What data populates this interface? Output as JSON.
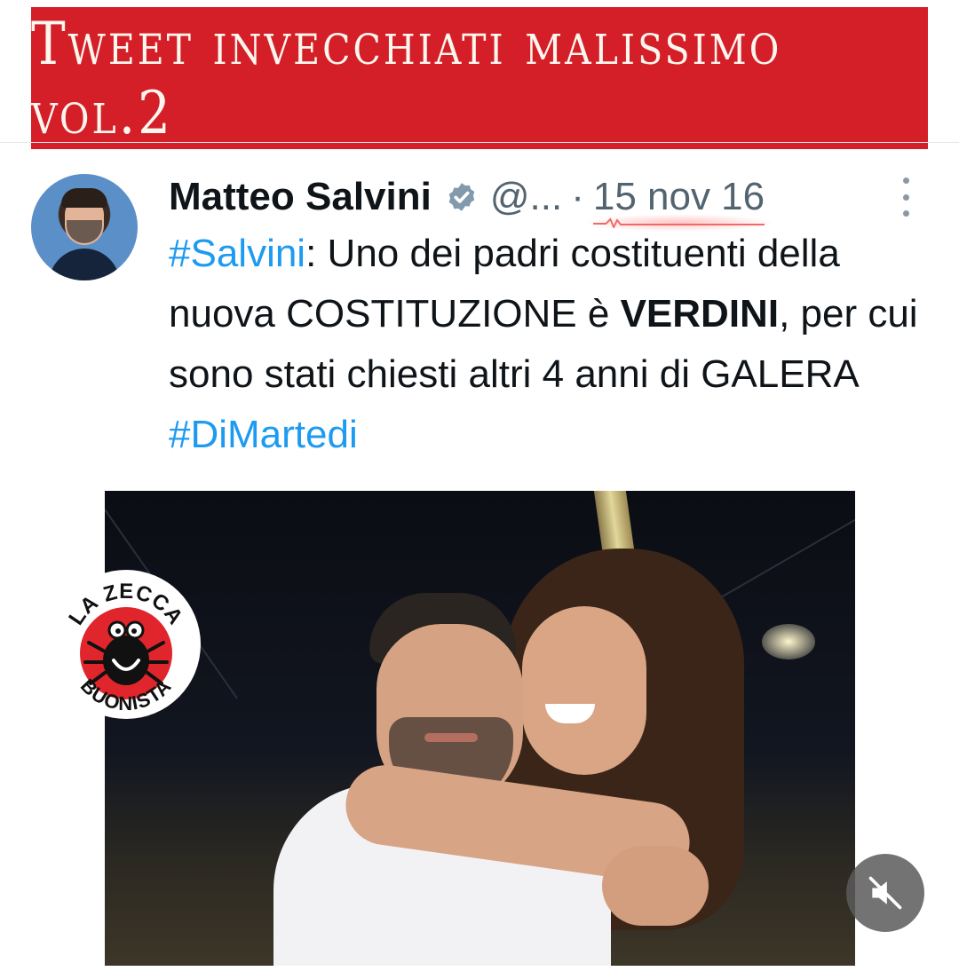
{
  "banner": {
    "title": "Tweet invecchiati malissimo vol.2"
  },
  "tweet": {
    "author_name": "Matteo Salvini",
    "handle": "@...",
    "separator": "·",
    "date": "15 nov 16",
    "text": {
      "hashtag_1": "#Salvini",
      "part_1": ": Uno dei padri costituenti della nuova COSTITUZIONE è ",
      "bold": "VERDINI",
      "part_2": ", per cui sono stati chiesti altri 4 anni di GALERA ",
      "hashtag_2": "#DiMartedi"
    }
  },
  "logo": {
    "top_text": "LA ZECCA",
    "bottom_text": "BUONISTA"
  },
  "colors": {
    "banner": "#d41f28",
    "hashtag": "#1d9bf0",
    "muted_text": "#536471",
    "logo_red": "#e0262c"
  },
  "icons": {
    "verified": "verified-badge-icon",
    "more": "more-options-icon",
    "mute": "speaker-muted-icon"
  }
}
